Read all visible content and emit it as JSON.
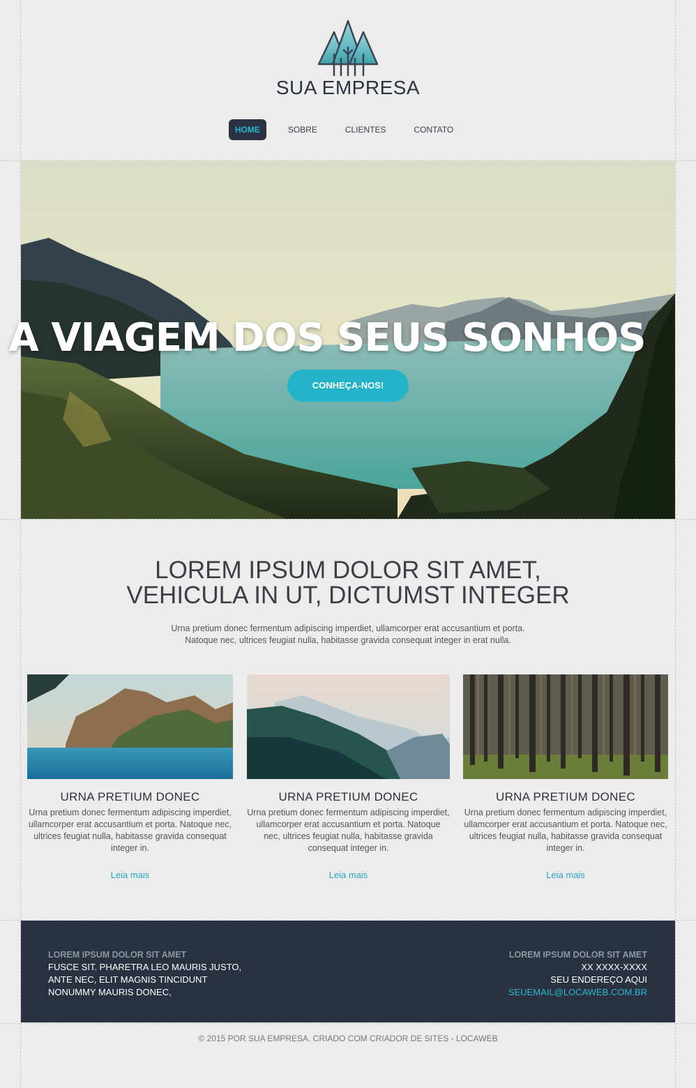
{
  "header": {
    "brand": "SUA EMPRESA"
  },
  "nav": {
    "items": [
      {
        "label": "HOME",
        "active": true
      },
      {
        "label": "SOBRE",
        "active": false
      },
      {
        "label": "CLIENTES",
        "active": false
      },
      {
        "label": "CONTATO",
        "active": false
      }
    ]
  },
  "hero": {
    "title": "A VIAGEM DOS SEUS SONHOS",
    "button_label": "CONHEÇA-NOS!"
  },
  "intro": {
    "title_line1": "LOREM IPSUM DOLOR SIT AMET,",
    "title_line2": "VEHICULA IN UT, DICTUMST INTEGER",
    "text": "Urna pretium donec fermentum adipiscing imperdiet, ullamcorper erat accusantium et porta. Natoque nec, ultrices feugiat nulla, habitasse gravida consequat integer in erat nulla."
  },
  "cards": [
    {
      "title": "URNA PRETIUM DONEC",
      "text": "Urna pretium donec fermentum adipiscing imperdiet, ullamcorper erat accusantium et porta. Natoque nec, ultrices feugiat nulla, habitasse gravida consequat integer in.",
      "link": "Leia mais",
      "image": "island-coast"
    },
    {
      "title": "URNA PRETIUM DONEC",
      "text": "Urna pretium donec fermentum adipiscing imperdiet, ullamcorper erat accusantium et porta. Natoque nec, ultrices feugiat nulla, habitasse gravida consequat integer in.",
      "link": "Leia mais",
      "image": "mountain-forest"
    },
    {
      "title": "URNA PRETIUM DONEC",
      "text": "Urna pretium donec fermentum adipiscing imperdiet, ullamcorper erat accusantium et porta. Natoque nec, ultrices feugiat nulla, habitasse gravida consequat integer in.",
      "link": "Leia mais",
      "image": "pine-woods"
    }
  ],
  "footer": {
    "left_heading": "LOREM IPSUM DOLOR SIT AMET",
    "left_lines": [
      "FUSCE SIT. PHARETRA LEO MAURIS JUSTO,",
      "ANTE NEC, ELIT MAGNIS TINCIDUNT",
      "NONUMMY MAURIS DONEC,"
    ],
    "right_heading": "LOREM IPSUM DOLOR SIT AMET",
    "phone": "XX XXXX-XXXX",
    "address": "SEU ENDEREÇO AQUI",
    "email": "SEUEMAIL@LOCAWEB.COM.BR"
  },
  "copyright": "© 2015 POR SUA EMPRESA. CRIADO COM CRIADOR DE SITES - LOCAWEB",
  "colors": {
    "accent": "#22b3c8",
    "dark": "#2a3241",
    "background": "#ececec"
  }
}
